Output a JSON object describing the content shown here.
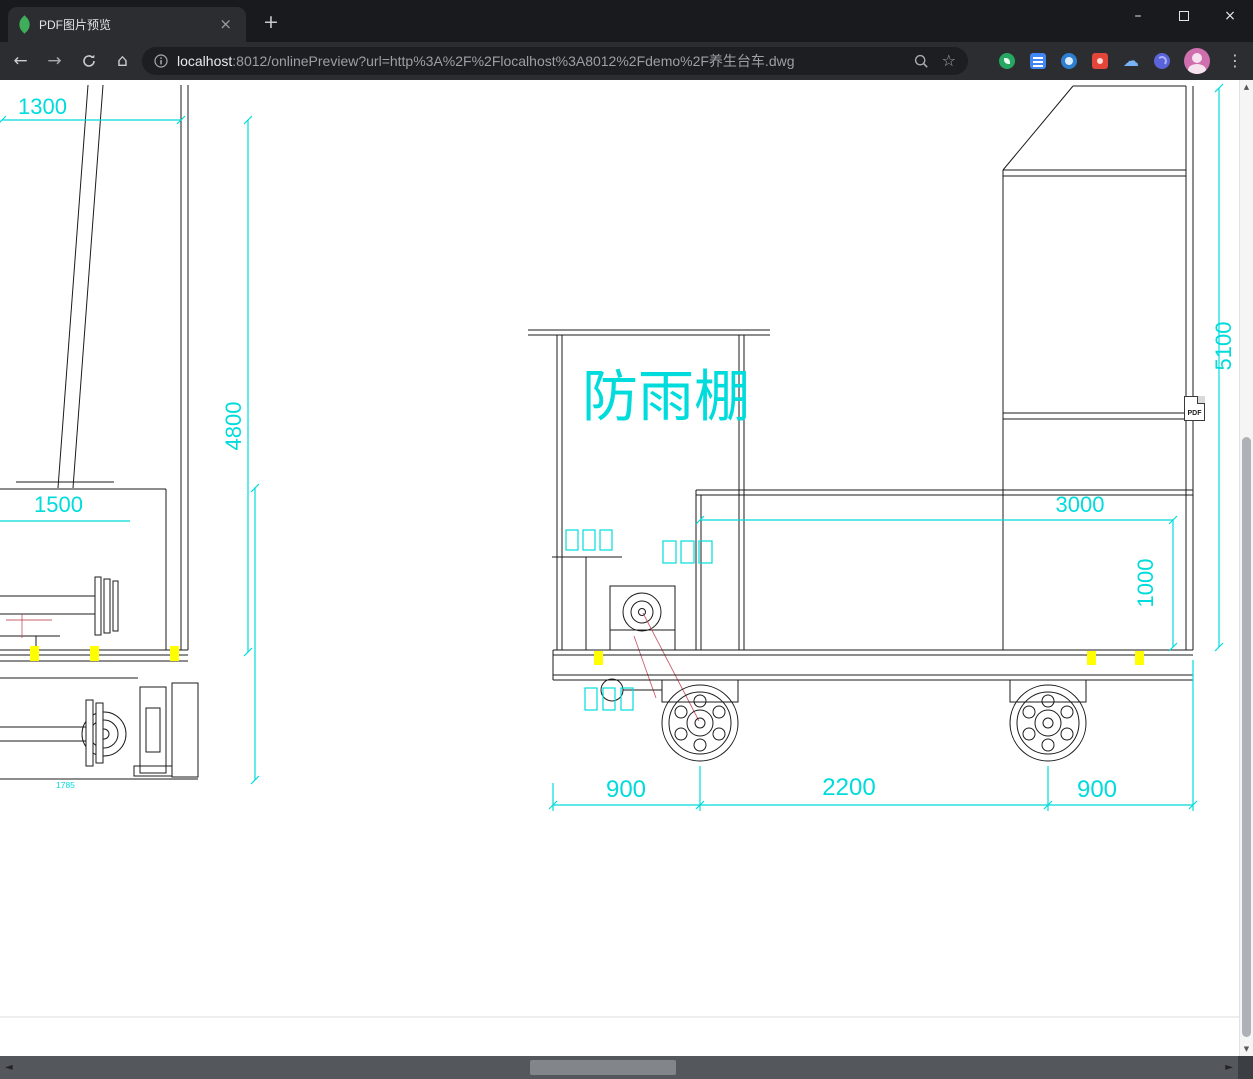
{
  "browser": {
    "tab": {
      "title": "PDF图片预览"
    },
    "address": {
      "host": "localhost",
      "rest": ":8012/onlinePreview?url=http%3A%2F%2Flocalhost%3A8012%2Fdemo%2F养生台车.dwg"
    },
    "glyphs": {
      "close": "×",
      "plus": "+",
      "minimize": "–",
      "back": "←",
      "forward": "→",
      "home": "⌂",
      "star": "☆",
      "menu": "⋮",
      "cloud": "☁",
      "up_arrow": "▲",
      "down_arrow": "▼",
      "left_arrow": "◄",
      "right_arrow": "►"
    }
  },
  "drawing": {
    "shelter_label": "防雨棚",
    "pdf_badge": "PDF",
    "dims": {
      "top_width": "1300",
      "left_total_height": "4800",
      "left_box_width": "1500",
      "right_total_height": "5100",
      "platform_length": "3000",
      "platform_height": "1000",
      "left_wheel_offset": "900",
      "wheel_spacing": "2200",
      "right_wheel_offset": "900",
      "left_lower_width": "1785"
    }
  },
  "colors": {
    "dimension_cyan": "#00dbdb",
    "highlight_yellow": "#ffff00",
    "leader_red": "#c04455",
    "line_black": "#1b1b1b",
    "frame_dark": "#191a1d",
    "toolbar_dark": "#2b2d31"
  }
}
